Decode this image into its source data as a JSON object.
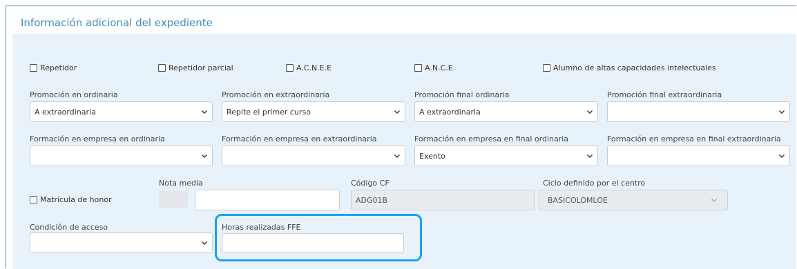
{
  "panel": {
    "title": "Información adicional del expediente"
  },
  "checkboxes": [
    {
      "label": "Repetidor",
      "checked": false
    },
    {
      "label": "Repetidor parcial",
      "checked": false
    },
    {
      "label": "A.C.N.E.E",
      "checked": false
    },
    {
      "label": "A.N.C.E.",
      "checked": false
    },
    {
      "label": "Alumno de altas capacidades intelectuales",
      "checked": false
    }
  ],
  "promocion": {
    "ordinaria": {
      "label": "Promoción en ordinaria",
      "value": "A extraordinaria"
    },
    "extraordinaria": {
      "label": "Promoción en extraordinaria",
      "value": "Repite el primer curso"
    },
    "final_ordinaria": {
      "label": "Promoción final ordinaria",
      "value": "A extraordinaria"
    },
    "final_extraordinaria": {
      "label": "Promoción final extraordinaria",
      "value": ""
    }
  },
  "formacion": {
    "ordinaria": {
      "label": "Formación en empresa en ordinaria",
      "value": ""
    },
    "extraordinaria": {
      "label": "Formación en empresa en extraordinaria",
      "value": ""
    },
    "final_ordinaria": {
      "label": "Formación en empresa en final ordinaria",
      "value": "Exento"
    },
    "final_extraordinaria": {
      "label": "Formación en empresa en final extraordinaria",
      "value": ""
    }
  },
  "matricula": {
    "label": "Matrícula de honor",
    "checked": false
  },
  "nota_media": {
    "label": "Nota media",
    "value": ""
  },
  "codigo_cf": {
    "label": "Código CF",
    "value": "ADG01B"
  },
  "ciclo": {
    "label": "Ciclo definido por el centro",
    "value": "BASICOLOMLOE"
  },
  "condicion": {
    "label": "Condición de acceso",
    "value": ""
  },
  "horas": {
    "label": "Horas realizadas FFE",
    "value": ""
  },
  "colors": {
    "accent": "#3b8dc2",
    "highlight": "#1ba0ef",
    "panel_bg": "#e8f2fa"
  }
}
